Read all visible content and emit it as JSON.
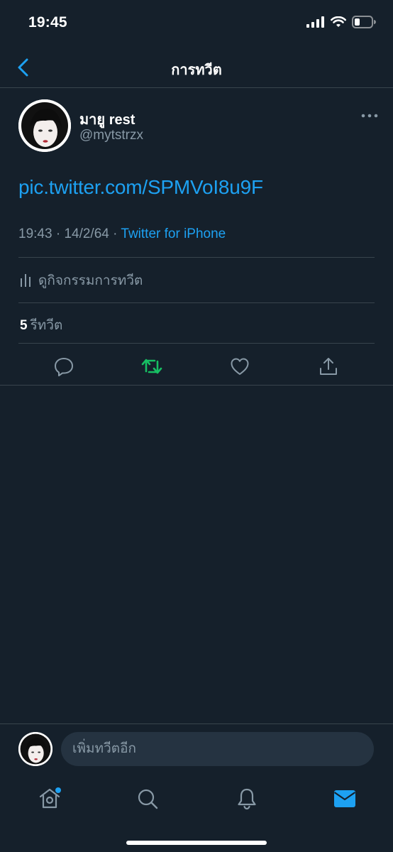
{
  "status_bar": {
    "time": "19:45"
  },
  "header": {
    "title": "การทวีต"
  },
  "tweet": {
    "author": {
      "display_name": "มายู rest",
      "handle": "@mytstrzx"
    },
    "link": "pic.twitter.com/SPMVoI8u9F",
    "time": "19:43",
    "date": "14/2/64",
    "separator": "·",
    "source": "Twitter for iPhone",
    "activity_label": "ดูกิจกรรมการทวีต",
    "retweet_count": "5",
    "retweet_label": "รีทวีต",
    "retweeted": true
  },
  "reply": {
    "placeholder": "เพิ่มทวีตอีก"
  },
  "tabs": [
    {
      "name": "home",
      "icon": "home-icon",
      "has_notification_dot": true
    },
    {
      "name": "search",
      "icon": "search-icon"
    },
    {
      "name": "notifications",
      "icon": "bell-icon"
    },
    {
      "name": "messages",
      "icon": "mail-icon",
      "active": true
    }
  ],
  "colors": {
    "background": "#15202b",
    "accent": "#1da1f2",
    "retweet_active": "#17bf63",
    "muted_text": "#8899a6",
    "divider": "#38444d"
  }
}
